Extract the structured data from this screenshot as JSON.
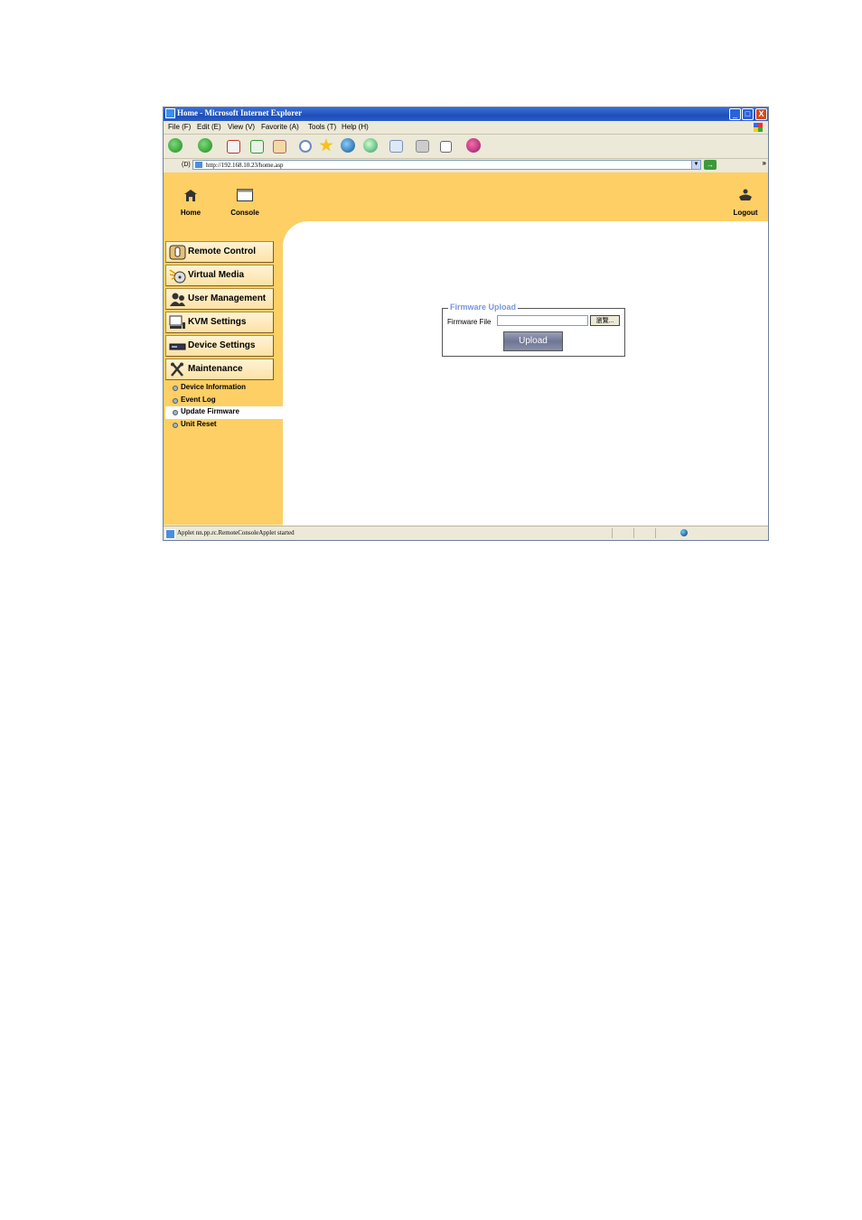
{
  "window": {
    "title": "Home - Microsoft Internet Explorer",
    "buttons": {
      "minimize": "_",
      "maximize": "□",
      "close": "X"
    }
  },
  "menubar": [
    "File (F)",
    "Edit (E)",
    "View (V)",
    "Favorite (A)",
    "Tools (T)",
    "Help (H)"
  ],
  "address": {
    "label": "(D)",
    "url": "http://192.168.10.23/home.asp",
    "go": "→",
    "more": "»"
  },
  "topnav": {
    "home_label": "Home",
    "console_label": "Console",
    "logout_label": "Logout"
  },
  "sidebar": {
    "menu": [
      {
        "label": "Remote Control",
        "icon": "remote-control-icon"
      },
      {
        "label": "Virtual Media",
        "icon": "virtual-media-icon"
      },
      {
        "label": "User Management",
        "icon": "user-management-icon"
      },
      {
        "label": "KVM Settings",
        "icon": "kvm-settings-icon"
      },
      {
        "label": "Device Settings",
        "icon": "device-settings-icon"
      },
      {
        "label": "Maintenance",
        "icon": "maintenance-icon"
      }
    ],
    "submenu": [
      {
        "label": "Device Information",
        "active": false
      },
      {
        "label": "Event Log",
        "active": false
      },
      {
        "label": "Update Firmware",
        "active": true
      },
      {
        "label": "Unit Reset",
        "active": false
      }
    ]
  },
  "firmware": {
    "legend": "Firmware Upload",
    "file_label": "Firmware File",
    "file_value": "",
    "browse_label": "瀏覽...",
    "upload_label": "Upload"
  },
  "status": {
    "text": "Applet nn.pp.rc.RemoteConsoleApplet started"
  },
  "colors": {
    "page_bg": "#fecf64",
    "legend": "#7a97dc",
    "titlebar": "#1e4fb8"
  }
}
